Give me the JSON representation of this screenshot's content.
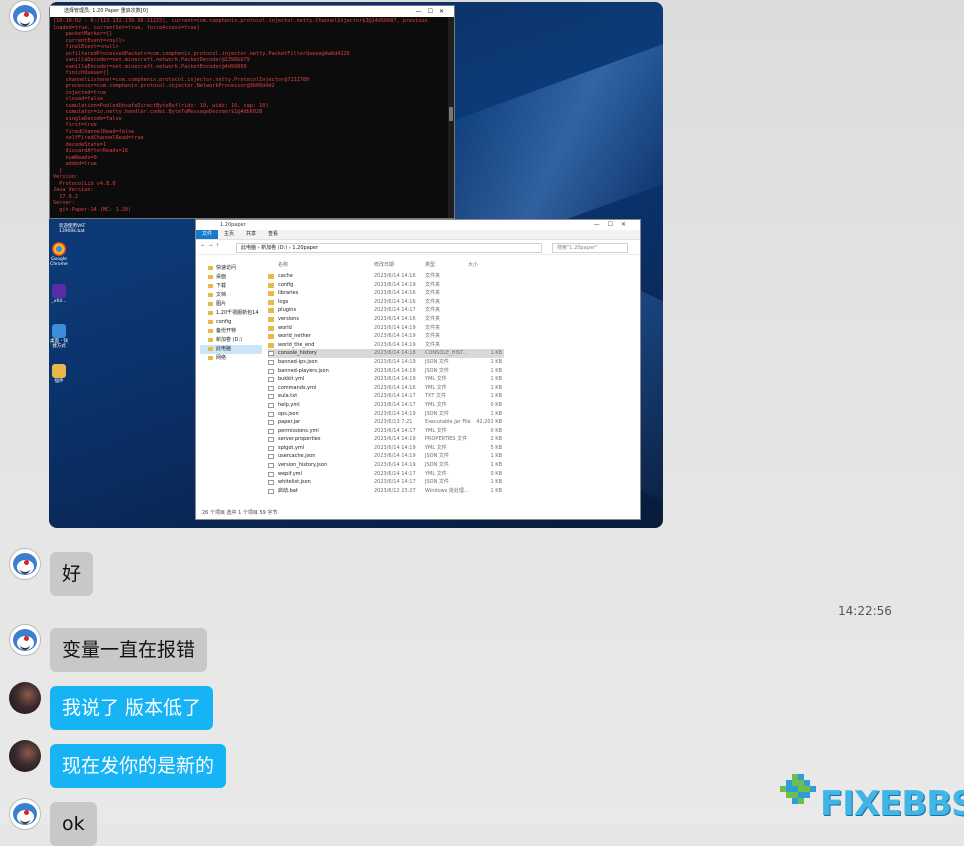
{
  "chat": {
    "image_message": {
      "console_window": {
        "title": "选择管理员: 1.20 Paper 重启次数[0]",
        "lines": [
          "[10:10:02 - R:/113.132.139.96:11215], current=com.comphenix.protocol.injector.netty.ChannelInjector$3@14d56687, previous",
          "loaded=true, currentSet=true, forceAccess=true]",
          "    packetMarker={}",
          "    currentEvent=<null>",
          "    finalEvent=<null>",
          "    unfilteredProcessedPackets=com.comphenix.protocol.injector.netty.PacketFilterQueue@4a6d4126",
          "    vanillaDecoder=net.minecraft.network.PacketDecoder@1398bb79",
          "    vanillaEncoder=net.minecraft.network.PacketEncoder@4d99009",
          "    finishQueue=[]",
          "    channelListener=com.comphenix.protocol.injector.netty.ProtocolInjector@7232780",
          "    processor=com.comphenix.protocol.injector.NetworkProcessor@3b00d4d2",
          "    injected=true",
          "    closed=false",
          "    cumulation=PooledUnsafeDirectByteBuf(ridx: 10, widx: 10, cap: 10)",
          "    cumulator=io.netty.handler.codec.ByteToMessageDecoder$1@4db6028",
          "    singleDecode=false",
          "    first=true",
          "    firedChannelRead=false",
          "    selfFiredChannelRead=true",
          "    decodeState=1",
          "    discardAfterReads=16",
          "    numReads=0",
          "    added=true",
          "  }",
          "Version:",
          "  ProtocolLib v4.8.0",
          "Java Version:",
          "  17.0.2",
          "Server:",
          "  git-Paper-14 (MC: 1.20)"
        ]
      },
      "desktop": {
        "taskbar_label_line1": "欢迎使用VAT",
        "taskbar_label_line2": "13900k.bat",
        "icons": [
          {
            "label_line1": "Google",
            "label_line2": "Chrome"
          },
          {
            "label_line1": "_x64...",
            "label_line2": ""
          },
          {
            "label_line1": "桌面 - 快",
            "label_line2": "捷方式"
          },
          {
            "label_line1": "插件",
            "label_line2": ""
          }
        ]
      },
      "explorer": {
        "title": "1.20paper",
        "menu": [
          "文件",
          "主页",
          "共享",
          "查看"
        ],
        "path": "此电脑 › 新加卷 (D:) › 1.20paper",
        "search_placeholder": "搜索\"1.20paper\"",
        "nav_items": [
          {
            "label": "快速访问",
            "icon": "star-icon"
          },
          {
            "label": "桌面",
            "icon": "desktop-icon"
          },
          {
            "label": "下载",
            "icon": "download-icon"
          },
          {
            "label": "文档",
            "icon": "document-icon"
          },
          {
            "label": "图片",
            "icon": "picture-icon"
          },
          {
            "label": "1.20千禧服新包14",
            "icon": "folder-icon"
          },
          {
            "label": "config",
            "icon": "folder-icon"
          },
          {
            "label": "备份开特",
            "icon": "folder-icon"
          },
          {
            "label": "新加卷 (D:)",
            "icon": "drive-icon"
          },
          {
            "label": "此电脑",
            "icon": "computer-icon"
          },
          {
            "label": "网络",
            "icon": "network-icon"
          }
        ],
        "columns": {
          "name": "名称",
          "date": "修改日期",
          "type": "类型",
          "size": "大小"
        },
        "files": [
          {
            "name": "cache",
            "date": "2023/6/14 14:16",
            "type": "文件夹",
            "size": "",
            "kind": "folder"
          },
          {
            "name": "config",
            "date": "2023/6/14 14:19",
            "type": "文件夹",
            "size": "",
            "kind": "folder"
          },
          {
            "name": "libraries",
            "date": "2023/6/14 14:16",
            "type": "文件夹",
            "size": "",
            "kind": "folder"
          },
          {
            "name": "logs",
            "date": "2023/6/14 14:16",
            "type": "文件夹",
            "size": "",
            "kind": "folder"
          },
          {
            "name": "plugins",
            "date": "2023/6/14 14:17",
            "type": "文件夹",
            "size": "",
            "kind": "folder"
          },
          {
            "name": "versions",
            "date": "2023/6/14 14:16",
            "type": "文件夹",
            "size": "",
            "kind": "folder"
          },
          {
            "name": "world",
            "date": "2023/6/14 14:19",
            "type": "文件夹",
            "size": "",
            "kind": "folder"
          },
          {
            "name": "world_nether",
            "date": "2023/6/14 14:19",
            "type": "文件夹",
            "size": "",
            "kind": "folder"
          },
          {
            "name": "world_the_end",
            "date": "2023/6/14 14:19",
            "type": "文件夹",
            "size": "",
            "kind": "folder"
          },
          {
            "name": "console_history",
            "date": "2023/6/14 14:18",
            "type": "CONSOLE_HIST...",
            "size": "1 KB",
            "kind": "file"
          },
          {
            "name": "banned-ips.json",
            "date": "2023/6/14 14:19",
            "type": "JSON 文件",
            "size": "1 KB",
            "kind": "file"
          },
          {
            "name": "banned-players.json",
            "date": "2023/6/14 14:19",
            "type": "JSON 文件",
            "size": "1 KB",
            "kind": "file"
          },
          {
            "name": "bukkit.yml",
            "date": "2023/6/14 14:19",
            "type": "YML 文件",
            "size": "1 KB",
            "kind": "file"
          },
          {
            "name": "commands.yml",
            "date": "2023/6/14 14:16",
            "type": "YML 文件",
            "size": "1 KB",
            "kind": "file"
          },
          {
            "name": "eula.txt",
            "date": "2023/6/14 14:17",
            "type": "TXT 文件",
            "size": "1 KB",
            "kind": "file"
          },
          {
            "name": "help.yml",
            "date": "2023/6/14 14:17",
            "type": "YML 文件",
            "size": "0 KB",
            "kind": "file"
          },
          {
            "name": "ops.json",
            "date": "2023/6/14 14:19",
            "type": "JSON 文件",
            "size": "1 KB",
            "kind": "file"
          },
          {
            "name": "paper.jar",
            "date": "2023/6/13 7:21",
            "type": "Executable Jar File",
            "size": "42,201 KB",
            "kind": "file"
          },
          {
            "name": "permissions.yml",
            "date": "2023/6/14 14:17",
            "type": "YML 文件",
            "size": "0 KB",
            "kind": "file"
          },
          {
            "name": "server.properties",
            "date": "2023/6/14 14:19",
            "type": "PROPERTIES 文件",
            "size": "2 KB",
            "kind": "file"
          },
          {
            "name": "spigot.yml",
            "date": "2023/6/14 14:19",
            "type": "YML 文件",
            "size": "5 KB",
            "kind": "file"
          },
          {
            "name": "usercache.json",
            "date": "2023/6/14 14:19",
            "type": "JSON 文件",
            "size": "1 KB",
            "kind": "file"
          },
          {
            "name": "version_history.json",
            "date": "2023/6/14 14:19",
            "type": "JSON 文件",
            "size": "1 KB",
            "kind": "file"
          },
          {
            "name": "wepif.yml",
            "date": "2023/6/14 14:17",
            "type": "YML 文件",
            "size": "0 KB",
            "kind": "file"
          },
          {
            "name": "whitelist.json",
            "date": "2023/6/14 14:17",
            "type": "JSON 文件",
            "size": "1 KB",
            "kind": "file"
          },
          {
            "name": "启动.bat",
            "date": "2023/6/12 23:27",
            "type": "Windows 批处理...",
            "size": "1 KB",
            "kind": "file"
          }
        ],
        "status": "26 个项目    选中 1 个项目 59 字节"
      }
    },
    "messages": [
      {
        "text": "好",
        "style": "gray"
      },
      {
        "text": "变量一直在报错",
        "style": "gray"
      },
      {
        "text": "我说了 版本低了",
        "style": "blue"
      },
      {
        "text": "现在发你的是新的",
        "style": "blue"
      },
      {
        "text": "ok",
        "style": "gray"
      }
    ],
    "timestamp": "14:22:56"
  },
  "watermark": {
    "text": "FIXEBBS"
  }
}
